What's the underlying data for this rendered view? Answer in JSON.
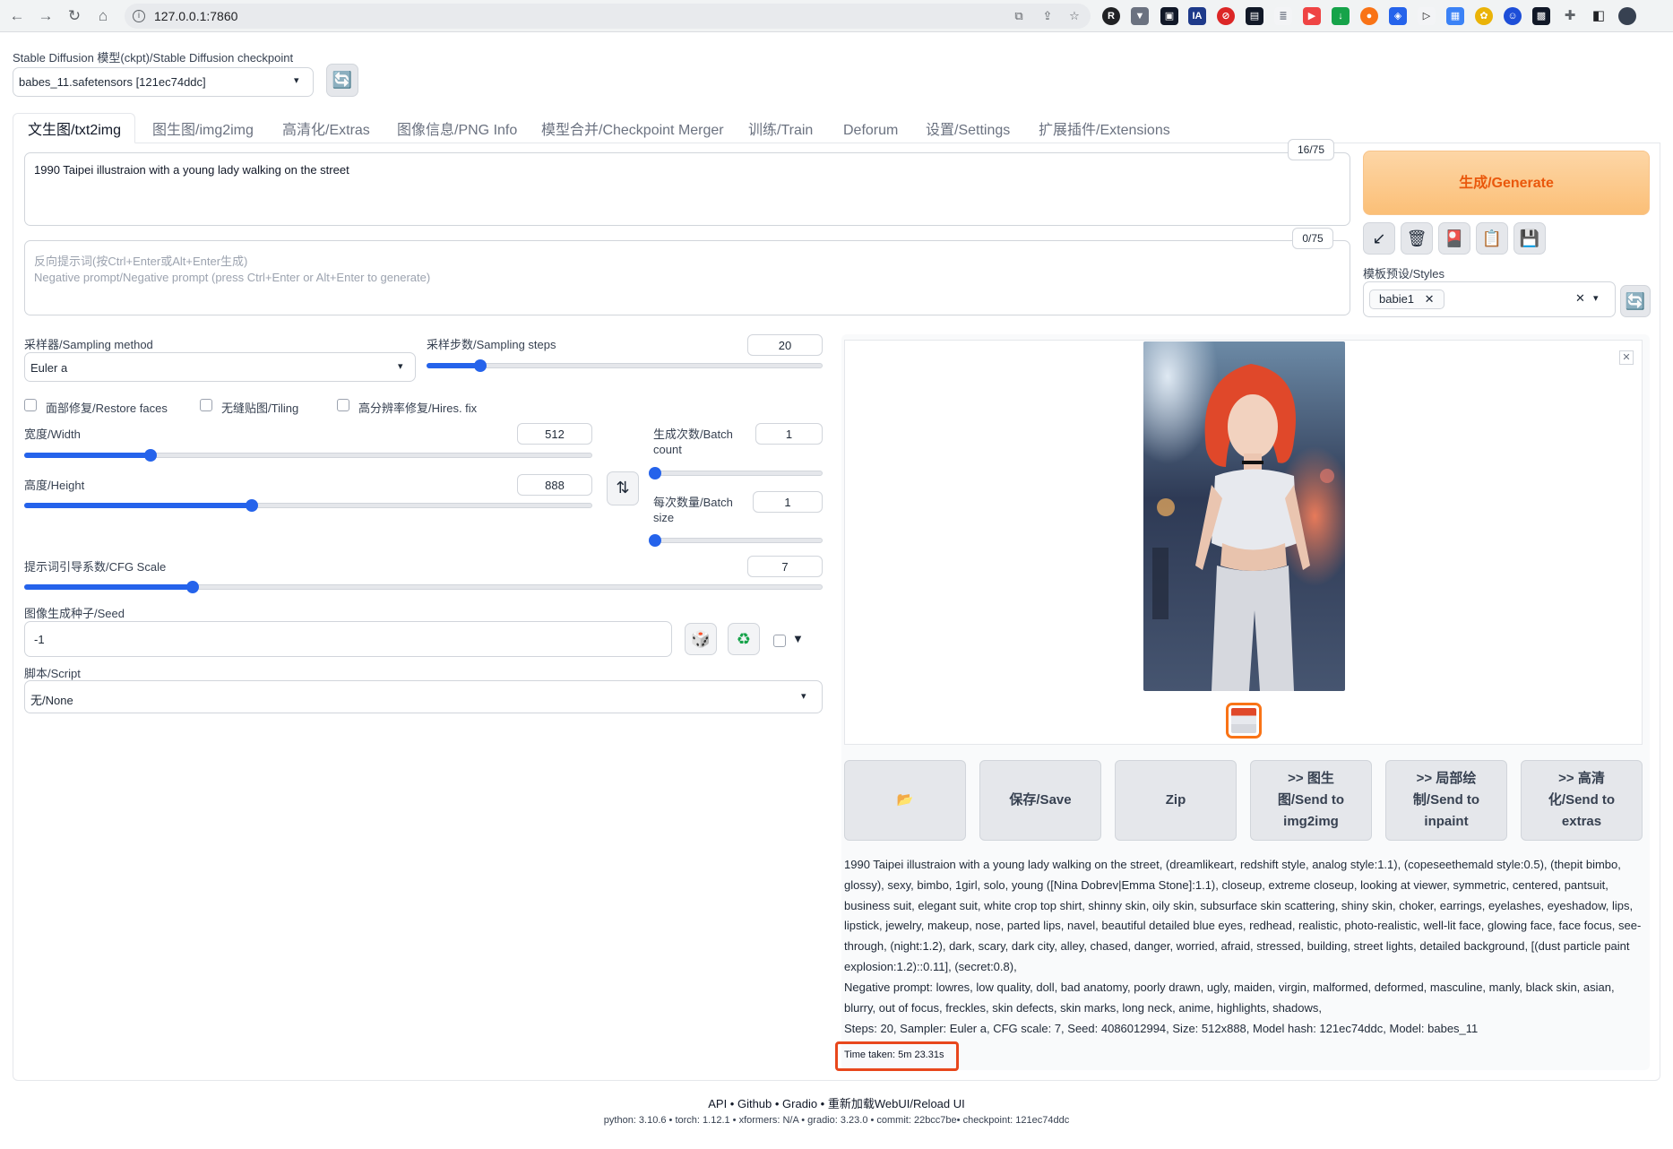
{
  "browser": {
    "url": "127.0.0.1:7860"
  },
  "checkpoint": {
    "label": "Stable Diffusion 模型(ckpt)/Stable Diffusion checkpoint",
    "value": "babes_11.safetensors [121ec74ddc]"
  },
  "tabs": [
    "文生图/txt2img",
    "图生图/img2img",
    "高清化/Extras",
    "图像信息/PNG Info",
    "模型合并/Checkpoint Merger",
    "训练/Train",
    "Deforum",
    "设置/Settings",
    "扩展插件/Extensions"
  ],
  "prompt": {
    "value": "1990 Taipei illustraion with a young lady walking on the street",
    "token_count": "16/75"
  },
  "negative_prompt": {
    "placeholder_line1": "反向提示词(按Ctrl+Enter或Alt+Enter生成)",
    "placeholder_line2": "Negative prompt/Negative prompt (press Ctrl+Enter or Alt+Enter to generate)",
    "token_count": "0/75"
  },
  "generate_label": "生成/Generate",
  "styles": {
    "label": "模板预设/Styles",
    "selected": "babie1"
  },
  "sampling": {
    "method_label": "采样器/Sampling method",
    "method_value": "Euler a",
    "steps_label": "采样步数/Sampling steps",
    "steps_value": "20",
    "steps_fraction": 0.133
  },
  "options": {
    "restore_faces": "面部修复/Restore faces",
    "tiling": "无缝贴图/Tiling",
    "hires_fix": "高分辨率修复/Hires. fix"
  },
  "width": {
    "label": "宽度/Width",
    "value": "512",
    "fraction": 0.222
  },
  "height": {
    "label": "高度/Height",
    "value": "888",
    "fraction": 0.4
  },
  "batch_count": {
    "label_line1": "生成次数/Batch",
    "label_line2": "count",
    "value": "1",
    "fraction": 0
  },
  "batch_size": {
    "label_line1": "每次数量/Batch",
    "label_line2": "size",
    "value": "1",
    "fraction": 0
  },
  "cfg": {
    "label": "提示词引导系数/CFG Scale",
    "value": "7",
    "fraction": 0.21
  },
  "seed": {
    "label": "图像生成种子/Seed",
    "value": "-1"
  },
  "script": {
    "label": "脚本/Script",
    "value": "无/None"
  },
  "output_buttons": {
    "save": "保存/Save",
    "zip": "Zip",
    "send_img2img": ">> 图生图/Send to img2img",
    "send_inpaint": ">> 局部绘制/Send to inpaint",
    "send_extras": ">> 高清化/Send to extras"
  },
  "info": {
    "prompt_text": "1990 Taipei illustraion with a young lady walking on the street, (dreamlikeart, redshift style, analog style:1.1), (copeseethemald style:0.5), (thepit bimbo, glossy), sexy, bimbo, 1girl, solo, young ([Nina Dobrev|Emma Stone]:1.1), closeup, extreme closeup, looking at viewer, symmetric, centered, pantsuit, business suit, elegant suit, white crop top shirt, shinny skin, oily skin, subsurface skin scattering, shiny skin, choker, earrings, eyelashes, eyeshadow, lips, lipstick, jewelry, makeup, nose, parted lips, navel, beautiful detailed blue eyes, redhead, realistic, photo-realistic, well-lit face, glowing face, face focus, see-through, (night:1.2), dark, scary, dark city, alley, chased, danger, worried, afraid, stressed, building, street lights, detailed background, [(dust particle paint explosion:1.2)::0.11], (secret:0.8),",
    "negative_text": "Negative prompt: lowres, low quality, doll, bad anatomy, poorly drawn, ugly, maiden, virgin, malformed, deformed, masculine, manly, black skin, asian, blurry, out of focus, freckles, skin defects, skin marks, long neck, anime, highlights, shadows,",
    "params_text": "Steps: 20, Sampler: Euler a, CFG scale: 7, Seed: 4086012994, Size: 512x888, Model hash: 121ec74ddc, Model: babes_11",
    "time_taken": "Time taken: 5m 23.31s"
  },
  "footer": {
    "links": "API  •  Github  •  Gradio  •  重新加载WebUI/Reload UI",
    "versions": "python: 3.10.6  •  torch: 1.12.1  •  xformers: N/A  •  gradio: 3.23.0  •  commit: 22bcc7be•  checkpoint: 121ec74ddc"
  },
  "colors": {
    "accent": "#2563eb",
    "generate_bg": "#fbbf77",
    "generate_text": "#ea580c",
    "highlight": "#e8471c"
  }
}
